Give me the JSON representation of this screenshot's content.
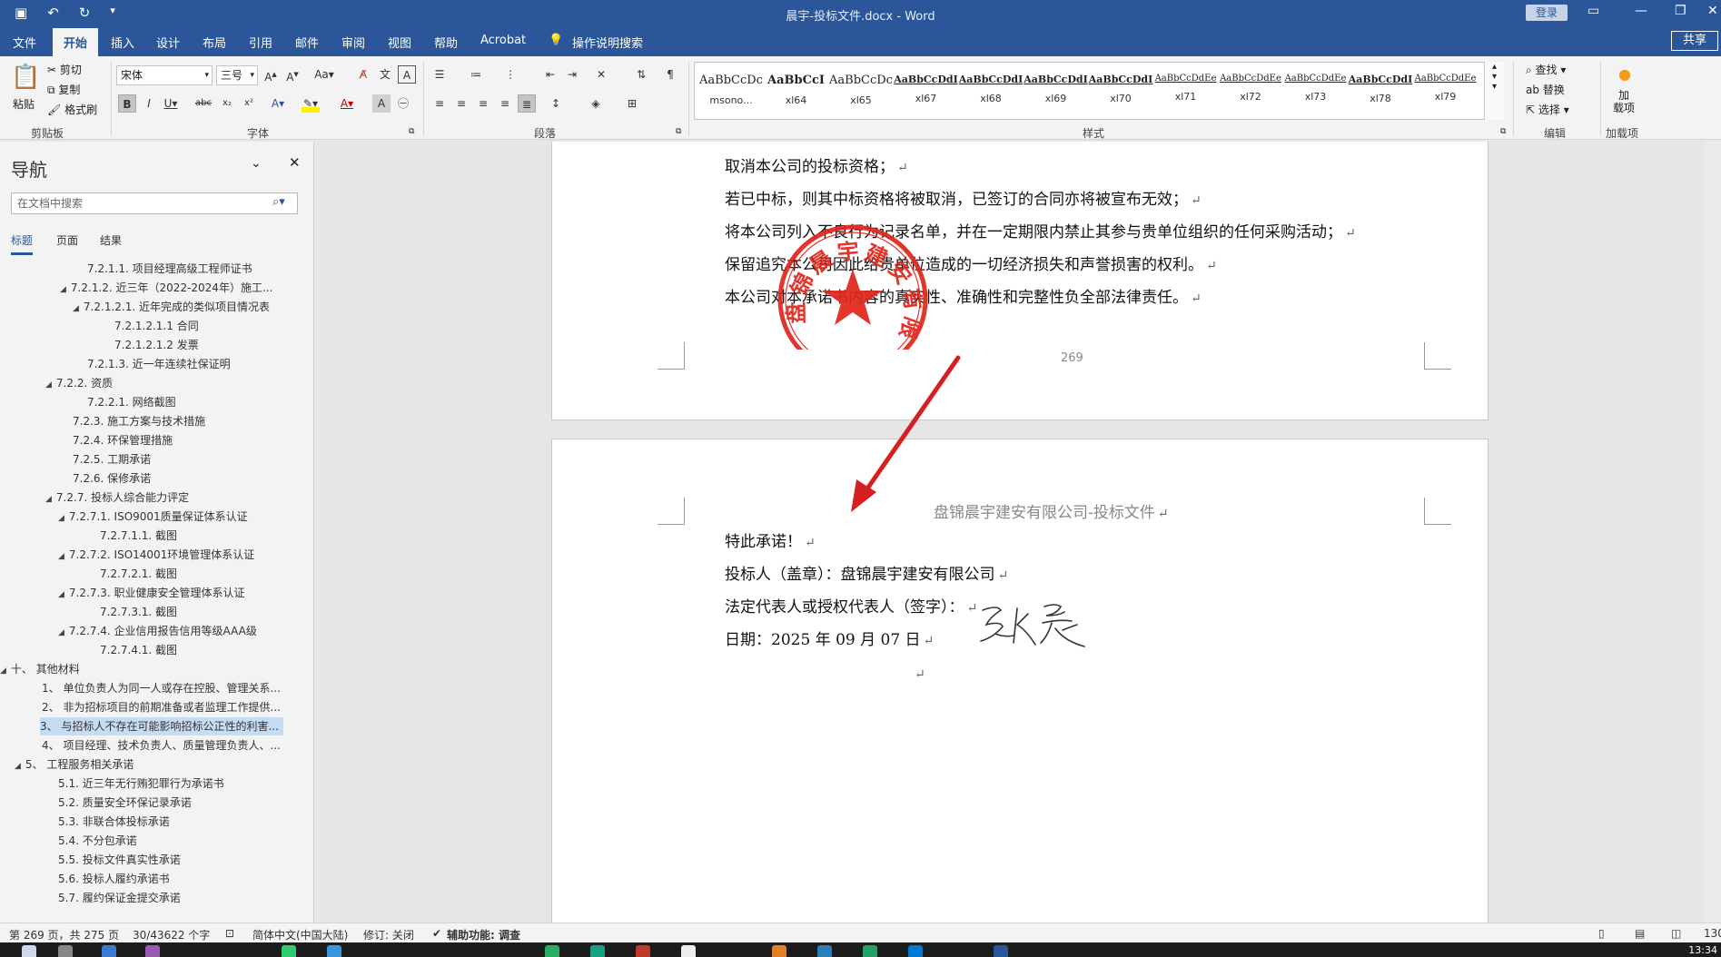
{
  "window": {
    "title": "晨宇-投标文件.docx  -  Word",
    "login_label": "登录",
    "share_label": "共享"
  },
  "menu": {
    "tabs": [
      "文件",
      "开始",
      "插入",
      "设计",
      "布局",
      "引用",
      "邮件",
      "审阅",
      "视图",
      "帮助",
      "Acrobat"
    ],
    "active_tab": "开始",
    "tell_me": "操作说明搜索"
  },
  "ribbon": {
    "clipboard": {
      "paste": "粘贴",
      "cut": "剪切",
      "copy": "复制",
      "format_painter": "格式刷",
      "group": "剪贴板"
    },
    "font": {
      "font_name": "宋体",
      "font_size": "三号",
      "group": "字体"
    },
    "paragraph": {
      "group": "段落"
    },
    "styles": {
      "group": "样式",
      "items": [
        {
          "sample": "AaBbCcDc",
          "name": "msono..."
        },
        {
          "sample": "AaBbCcI",
          "name": "xl64"
        },
        {
          "sample": "AaBbCcDc",
          "name": "xl65"
        },
        {
          "sample": "AaBbCcDdI",
          "name": "xl67"
        },
        {
          "sample": "AaBbCcDdI",
          "name": "xl68"
        },
        {
          "sample": "AaBbCcDdI",
          "name": "xl69"
        },
        {
          "sample": "AaBbCcDdI",
          "name": "xl70"
        },
        {
          "sample": "AaBbCcDdEe",
          "name": "xl71"
        },
        {
          "sample": "AaBbCcDdEe",
          "name": "xl72"
        },
        {
          "sample": "AaBbCcDdEe",
          "name": "xl73"
        },
        {
          "sample": "AaBbCcDdI",
          "name": "xl78"
        },
        {
          "sample": "AaBbCcDdEe",
          "name": "xl79"
        }
      ]
    },
    "editing": {
      "find": "查找",
      "replace": "替换",
      "select": "选择",
      "group": "编辑"
    },
    "addins": {
      "label": "加\n载项",
      "group": "加载项"
    }
  },
  "nav": {
    "title": "导航",
    "search_placeholder": "在文档中搜索",
    "tabs": [
      "标题",
      "页面",
      "结果"
    ],
    "active_tab": "标题",
    "items": [
      {
        "text": "7.2.1.1. 项目经理高级工程师证书",
        "tri": ""
      },
      {
        "text": "7.2.1.2. 近三年（2022-2024年）施工...",
        "tri": "◢"
      },
      {
        "text": "7.2.1.2.1. 近年完成的类似项目情况表",
        "tri": "◢"
      },
      {
        "text": "7.2.1.2.1.1 合同",
        "tri": ""
      },
      {
        "text": "7.2.1.2.1.2 发票",
        "tri": ""
      },
      {
        "text": "7.2.1.3. 近一年连续社保证明",
        "tri": ""
      },
      {
        "text": "7.2.2. 资质",
        "tri": "◢"
      },
      {
        "text": "7.2.2.1. 网络截图",
        "tri": ""
      },
      {
        "text": "7.2.3. 施工方案与技术措施",
        "tri": ""
      },
      {
        "text": "7.2.4. 环保管理措施",
        "tri": ""
      },
      {
        "text": "7.2.5. 工期承诺",
        "tri": ""
      },
      {
        "text": "7.2.6. 保修承诺",
        "tri": ""
      },
      {
        "text": "7.2.7. 投标人综合能力评定",
        "tri": "◢"
      },
      {
        "text": "7.2.7.1. ISO9001质量保证体系认证",
        "tri": "◢"
      },
      {
        "text": "7.2.7.1.1. 截图",
        "tri": ""
      },
      {
        "text": "7.2.7.2. ISO14001环境管理体系认证",
        "tri": "◢"
      },
      {
        "text": "7.2.7.2.1. 截图",
        "tri": ""
      },
      {
        "text": "7.2.7.3. 职业健康安全管理体系认证",
        "tri": "◢"
      },
      {
        "text": "7.2.7.3.1. 截图",
        "tri": ""
      },
      {
        "text": "7.2.7.4. 企业信用报告信用等级AAA级",
        "tri": "◢"
      },
      {
        "text": "7.2.7.4.1. 截图",
        "tri": ""
      },
      {
        "text": "十、 其他材料",
        "tri": "◢"
      },
      {
        "text": "1、 单位负责人为同一人或存在控股、管理关系...",
        "tri": ""
      },
      {
        "text": "2、 非为招标项目的前期准备或者监理工作提供...",
        "tri": ""
      },
      {
        "text": "3、 与招标人不存在可能影响招标公正性的利害...",
        "tri": ""
      },
      {
        "text": "4、 项目经理、技术负责人、质量管理负责人、...",
        "tri": ""
      },
      {
        "text": "5、 工程服务相关承诺",
        "tri": "◢"
      },
      {
        "text": "5.1. 近三年无行贿犯罪行为承诺书",
        "tri": ""
      },
      {
        "text": "5.2. 质量安全环保记录承诺",
        "tri": ""
      },
      {
        "text": "5.3. 非联合体投标承诺",
        "tri": ""
      },
      {
        "text": "5.4. 不分包承诺",
        "tri": ""
      },
      {
        "text": "5.5. 投标文件真实性承诺",
        "tri": ""
      },
      {
        "text": "5.6. 投标人履约承诺书",
        "tri": ""
      },
      {
        "text": "5.7. 履约保证金提交承诺",
        "tri": ""
      }
    ]
  },
  "document": {
    "page1_lines": [
      "取消本公司的投标资格；",
      "若已中标，则其中标资格将被取消，已签订的合同亦将被宣布无效；",
      "  将本公司列入不良行为记录名单，并在一定期限内禁止其参与贵单位组织的任何采购活动；",
      "保留追究本公司因此给贵单位造成的一切经济损失和声誉损害的权利。",
      "本公司对本承诺书内容的真实性、准确性和完整性负全部法律责任。"
    ],
    "page_number": "269",
    "header": "盘锦晨宇建安有限公司-投标文件",
    "page2_lines": [
      "特此承诺！",
      "投标人（盖章）：盘锦晨宇建安有限公司",
      " 法定代表人或授权代表人（签字）：",
      "日期：2025 年 09 月 07 日"
    ],
    "seal_text": "盘锦晨宇建安有限公司",
    "signature_text": "张晨"
  },
  "status": {
    "page": "第 269 页，共 275 页",
    "words": "30/43622 个字",
    "language": "简体中文(中国大陆)",
    "track": "修订: 关闭",
    "accessibility": "辅助功能: 调查",
    "zoom": "130"
  },
  "taskbar": {
    "time": "13:34"
  },
  "colors": {
    "word_blue": "#2b579a",
    "seal_red": "#e0261c",
    "arrow_red": "#d42020"
  }
}
